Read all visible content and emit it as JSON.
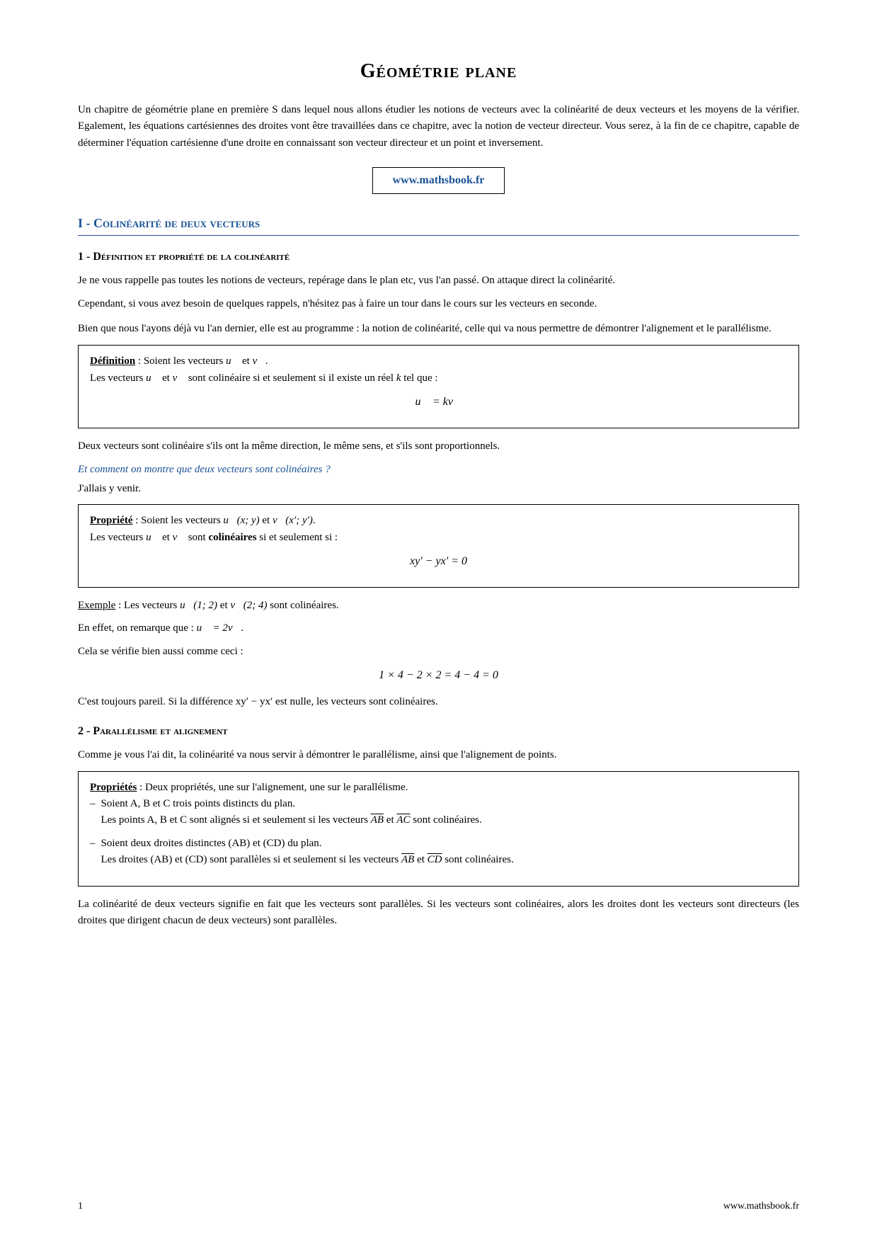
{
  "page": {
    "title": "Géométrie plane",
    "intro": "Un chapitre de géométrie plane en première S dans lequel nous allons étudier les notions de vecteurs avec la colinéarité de deux vecteurs et les moyens de la vérifier. Egalement, les équations cartésiennes des droites vont être travaillées dans ce chapitre, avec la notion de vecteur directeur. Vous serez, à la fin de ce chapitre, capable de déterminer l'équation cartésienne d'une droite en connaissant son vecteur directeur et un point et inversement.",
    "website": "www.mathsbook.fr",
    "section1": {
      "title": "I - Colinéarité de deux vecteurs",
      "subsection1": {
        "title": "1 - Définition et propriété de la colinéarité",
        "para1": "Je ne vous rappelle pas toutes les notions de vecteurs, repérage dans le plan etc, vus l'an passé. On attaque direct la colinéarité.",
        "para2": "Cependant, si vous avez besoin de quelques rappels, n'hésitez pas à faire un tour dans le cours sur les vecteurs en seconde.",
        "para3": "Bien que nous l'ayons déjà vu l'an dernier, elle est au programme : la notion de colinéarité, celle qui va nous permettre de démontrer l'alignement et le parallélisme.",
        "definition_label": "Définition",
        "definition_text1": " : Soient les vecteurs ",
        "definition_text2": " et ",
        "definition_text3": ".",
        "definition_line2a": "Les vecteurs ",
        "definition_line2b": " et ",
        "definition_line2c": " sont colinéaire si et seulement si il existe un réel ",
        "definition_line2d": "k",
        "definition_line2e": " tel que :",
        "definition_math": "u⃗ = kv⃗",
        "after_def": "Deux vecteurs sont colinéaire s'ils ont la même direction, le même sens, et s'ils sont proportionnels.",
        "italic_question": "Et comment on montre que deux vecteurs sont colinéaires ?",
        "after_question": "J'allais y venir.",
        "prop_label": "Propriété",
        "prop_text1": " : Soient les vecteurs ",
        "prop_text2": "u⃗(x; y)",
        "prop_text3": " et ",
        "prop_text4": "v⃗(x′; y′)",
        "prop_text5": ".",
        "prop_line2a": "Les vecteurs ",
        "prop_line2b": " et ",
        "prop_line2c": " sont ",
        "prop_line2d": "colinéaires",
        "prop_line2e": " si et seulement si :",
        "prop_math": "xy′ − yx′ = 0",
        "example_label": "Exemple",
        "example_text": " : Les vecteurs u⃗(1; 2) et v⃗(2; 4) sont colinéaires.",
        "example_para1a": "En effet, on remarque que : ",
        "example_para1b": "u⃗ = 2v⃗",
        "example_para1c": ".",
        "example_para2": "Cela se vérifie bien aussi comme ceci :",
        "example_math": "1 × 4 − 2 × 2 = 4 − 4 = 0",
        "conclusion": "C'est toujours pareil. Si la différence xy′ − yx′ est nulle, les vecteurs sont colinéaires."
      },
      "subsection2": {
        "title": "2 - Parallélisme et alignement",
        "para1": "Comme je vous l'ai dit, la colinéarité va nous servir à démontrer le parallélisme, ainsi que l'alignement de points.",
        "props_label": "Propriétés",
        "props_text": " : Deux propriétés, une sur l'alignement, une sur le parallélisme.",
        "item1_line1": "Soient A, B et C trois points distincts du plan.",
        "item1_line2a": "Les points A, B et C sont alignés si et seulement si les vecteurs ",
        "item1_line2b": "AB",
        "item1_line2c": " et ",
        "item1_line2d": "AC",
        "item1_line2e": " sont colinéaires.",
        "item2_line1": "Soient deux droites distinctes (AB) et (CD) du plan.",
        "item2_line2a": "Les droites (AB) et (CD) sont parallèles si et seulement si les vecteurs ",
        "item2_line2b": "AB",
        "item2_line2c": " et ",
        "item2_line2d": "CD",
        "item2_line2e": " sont colinéaires.",
        "final_para": "La colinéarité de deux vecteurs signifie en fait que les vecteurs sont parallèles. Si les vecteurs sont colinéaires, alors les droites dont les vecteurs sont directeurs (les droites que dirigent chacun de deux vecteurs) sont parallèles."
      }
    },
    "footer": {
      "page_number": "1",
      "website": "www.mathsbook.fr"
    }
  }
}
